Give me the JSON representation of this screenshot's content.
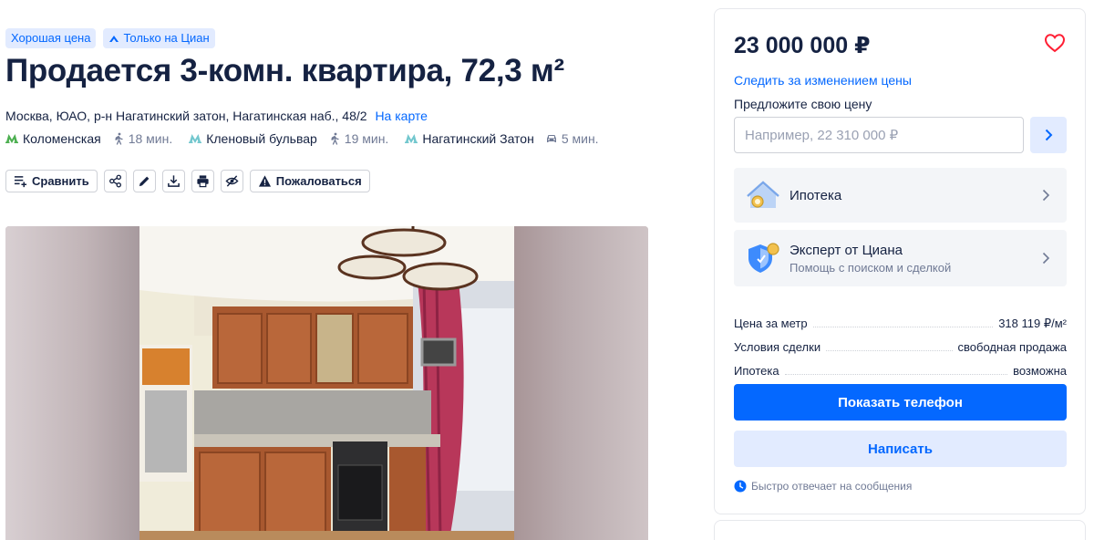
{
  "badges": {
    "good_price": "Хорошая цена",
    "only_cian": "Только на Циан"
  },
  "title": "Продается 3-комн. квартира, 72,3 м²",
  "address": {
    "text": "Москва, ЮАО, р-н Нагатинский затон, Нагатинская наб., 48/2",
    "map_link": "На карте"
  },
  "metro": [
    {
      "name": "Коломенская",
      "time": "18 мин.",
      "transport": "walk"
    },
    {
      "name": "Кленовый бульвар",
      "time": "19 мин.",
      "transport": "walk"
    },
    {
      "name": "Нагатинский Затон",
      "time": "5 мин.",
      "transport": "car"
    }
  ],
  "toolbar": {
    "compare": "Сравнить",
    "report": "Пожаловаться"
  },
  "sidebar": {
    "price": "23 000 000 ₽",
    "follow_price": "Следить за изменением цены",
    "offer_label": "Предложите свою цену",
    "offer_placeholder": "Например, 22 310 000 ₽",
    "mortgage": {
      "title": "Ипотека"
    },
    "expert": {
      "title": "Эксперт от Циана",
      "subtitle": "Помощь с поиском и сделкой"
    },
    "facts": [
      {
        "label": "Цена за метр",
        "value": "318 119 ₽/м²"
      },
      {
        "label": "Условия сделки",
        "value": "свободная продажа"
      },
      {
        "label": "Ипотека",
        "value": "возможна"
      }
    ],
    "show_phone": "Показать телефон",
    "write": "Написать",
    "quick_reply": "Быстро отвечает на сообщения"
  },
  "colors": {
    "accent": "#0468ff",
    "accent_light": "#e2ebff",
    "text": "#152242",
    "muted": "#707a95",
    "metro_green": "#4caf50",
    "metro_cyan": "#72c7ce",
    "heart": "#ff1f34"
  }
}
